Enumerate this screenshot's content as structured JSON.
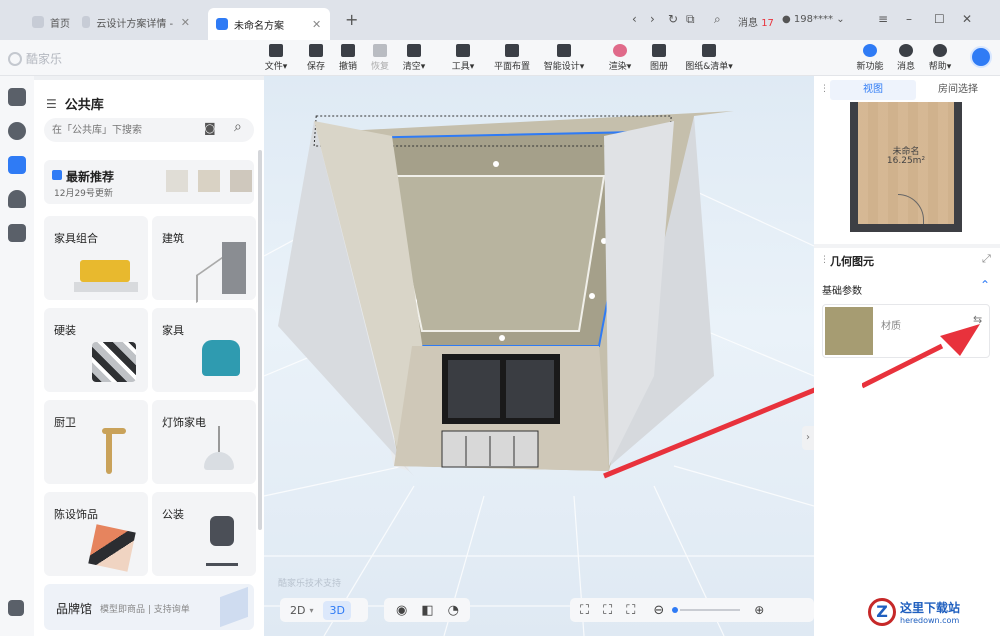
{
  "tabs": [
    {
      "label": "首页"
    },
    {
      "label": "云设计方案详情 - 酷家..."
    },
    {
      "label": "未命名方案"
    }
  ],
  "tabbar": {
    "message_label": "消息",
    "message_count": "17",
    "user_label": "198****"
  },
  "brand": {
    "name": "酷家乐"
  },
  "toolbar": {
    "file": "文件",
    "save": "保存",
    "undo": "撤销",
    "redo": "恢复",
    "clear": "清空",
    "tools": "工具",
    "floor_layout": "平面布置",
    "smart_design": "智能设计",
    "render": "渲染",
    "gallery": "图册",
    "drawings": "图纸&清单",
    "new_feature": "新功能",
    "messages": "消息",
    "help": "帮助"
  },
  "library": {
    "title": "公共库",
    "search_placeholder": "在「公共库」下搜索",
    "recommend_title": "最新推荐",
    "recommend_date": "12月29号更新",
    "categories": [
      {
        "label": "家具组合"
      },
      {
        "label": "建筑"
      },
      {
        "label": "硬装"
      },
      {
        "label": "家具"
      },
      {
        "label": "厨卫"
      },
      {
        "label": "灯饰家电"
      },
      {
        "label": "陈设饰品"
      },
      {
        "label": "公装"
      }
    ],
    "brand_hall_title": "品牌馆",
    "brand_hall_sub": "模型即商品 | 支持询单"
  },
  "viewport": {
    "watermark": "酷家乐技术支持",
    "mode_2d": "2D",
    "mode_3d": "3D"
  },
  "right": {
    "tab_view": "视图",
    "tab_room": "房间选择",
    "room_name": "未命名",
    "room_area": "16.25m²",
    "geo_title": "几何图元",
    "basic_params": "基础参数",
    "material_label": "材质"
  },
  "site": {
    "name": "这里下载站",
    "url": "heredown.com"
  },
  "colors": {
    "accent": "#2f7bf5",
    "material_swatch": "#a69c72",
    "arrow": "#e8323c"
  }
}
